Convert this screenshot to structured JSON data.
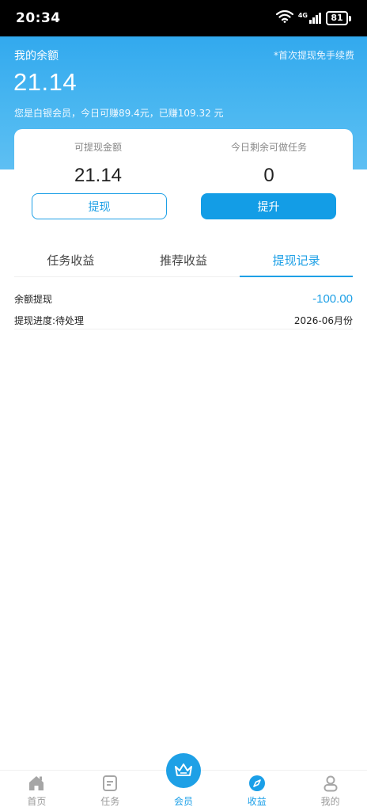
{
  "status_bar": {
    "time": "20:34",
    "network": "4G",
    "battery": "81"
  },
  "header": {
    "balance_title": "我的余额",
    "fee_note": "*首次提现免手续费",
    "balance_amount": "21.14",
    "member_note": "您是白银会员，今日可赚89.4元，已赚109.32 元"
  },
  "card": {
    "withdrawable_label": "可提现金额",
    "withdrawable_value": "21.14",
    "remaining_label": "今日剩余可做任务",
    "remaining_value": "0",
    "withdraw_button": "提现",
    "upgrade_button": "提升"
  },
  "tabs": [
    {
      "label": "任务收益",
      "active": false
    },
    {
      "label": "推荐收益",
      "active": false
    },
    {
      "label": "提现记录",
      "active": true
    }
  ],
  "records": [
    {
      "type": "余额提现",
      "amount": "-100.00",
      "status": "提现进度:待处理",
      "date": "2026-06月份"
    }
  ],
  "bottom_nav": [
    {
      "label": "首页",
      "icon": "home-icon",
      "active": false
    },
    {
      "label": "任务",
      "icon": "task-icon",
      "active": false
    },
    {
      "label": "会员",
      "icon": "crown-icon",
      "active": false
    },
    {
      "label": "收益",
      "icon": "compass-icon",
      "active": true
    },
    {
      "label": "我的",
      "icon": "user-icon",
      "active": false
    }
  ],
  "colors": {
    "accent": "#1ea0e6",
    "header_top": "#32a9ee",
    "header_bottom": "#5ebff3",
    "inactive_nav": "#9a9a9a"
  }
}
